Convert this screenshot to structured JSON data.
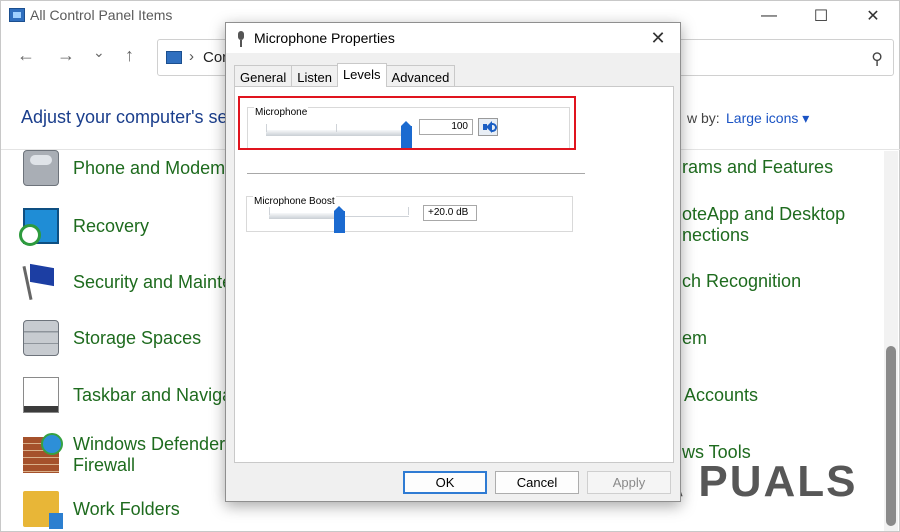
{
  "window": {
    "title": "All Control Panel Items",
    "minimize_glyph": "—",
    "maximize_glyph": "☐",
    "close_glyph": "✕"
  },
  "nav": {
    "back_glyph": "←",
    "forward_glyph": "→",
    "history_glyph": "⌄",
    "up_glyph": "↑",
    "breadcrumb_separator": "›",
    "address_text": "Con",
    "search_glyph": "⚲"
  },
  "main": {
    "heading": "Adjust your computer's se",
    "viewby_label": "w by:",
    "viewby_value": "Large icons ▾"
  },
  "items_left": [
    {
      "label": "Phone and Modem",
      "icon": "phone-modem-icon"
    },
    {
      "label": "Recovery",
      "icon": "recovery-icon"
    },
    {
      "label": "Security and Mainte",
      "icon": "security-flag-icon"
    },
    {
      "label": "Storage Spaces",
      "icon": "storage-spaces-icon"
    },
    {
      "label": "Taskbar and Naviga",
      "icon": "taskbar-icon"
    },
    {
      "label": "Windows Defender\nFirewall",
      "icon": "firewall-icon"
    },
    {
      "label": "Work Folders",
      "icon": "work-folders-icon"
    }
  ],
  "items_right": [
    {
      "label": "rams and Features"
    },
    {
      "label": "oteApp and Desktop\nnections"
    },
    {
      "label": "ch Recognition"
    },
    {
      "label": "em"
    },
    {
      "label": "Accounts"
    },
    {
      "label": "ws Tools"
    }
  ],
  "watermark": "A  PUALS",
  "dialog": {
    "title": "Microphone Properties",
    "close_glyph": "✕",
    "tabs": [
      {
        "label": "General",
        "active": false
      },
      {
        "label": "Listen",
        "active": false
      },
      {
        "label": "Levels",
        "active": true
      },
      {
        "label": "Advanced",
        "active": false
      }
    ],
    "microphone": {
      "label": "Microphone",
      "value": "100",
      "level": 100
    },
    "boost": {
      "label": "Microphone Boost",
      "value": "+20.0 dB",
      "level": 50
    },
    "buttons": {
      "ok": "OK",
      "cancel": "Cancel",
      "apply": "Apply"
    }
  },
  "colors": {
    "link_green": "#1e6b1e",
    "heading_blue": "#1a3e8c",
    "slider_blue": "#1b6ad0",
    "highlight_red": "#e0141e"
  }
}
